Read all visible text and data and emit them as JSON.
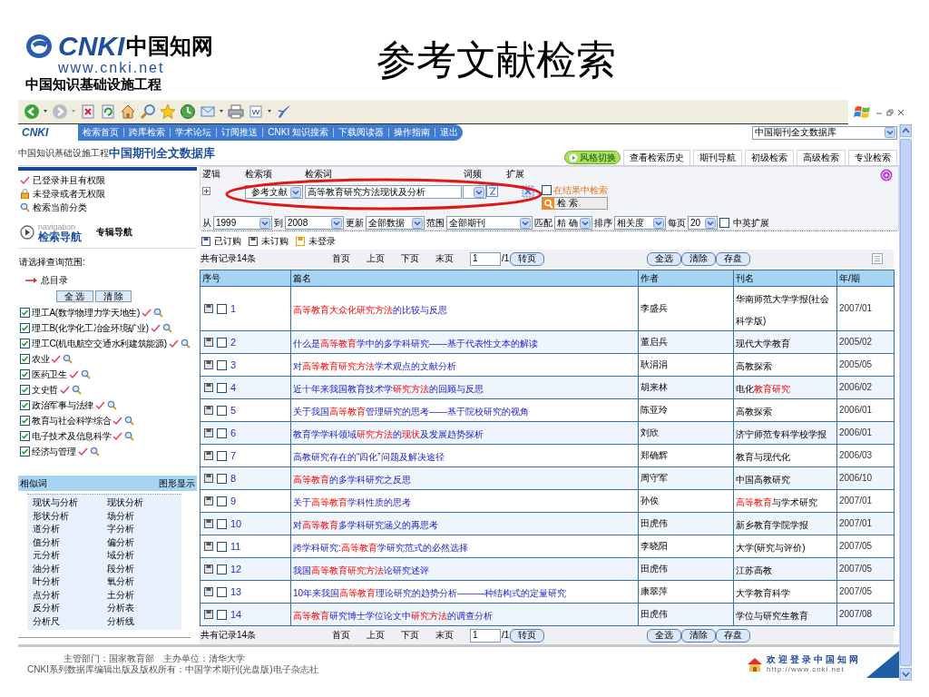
{
  "slide": {
    "logo_text": "CNKI",
    "logo_cn": "中国知网",
    "logo_url": "www.cnki.net",
    "logo_tagline": "中国知识基础设施工程",
    "title": "参考文献检索"
  },
  "site_nav": {
    "logo_text": "CNKI",
    "logo_tagline": "中国知识基础设施工程",
    "links": [
      "检索首页",
      "跨库检索",
      "学术论坛",
      "订阅推送",
      "CNKI 知识搜索",
      "下载阅读器",
      "操作指南",
      "退出"
    ],
    "db_select": "中国期刊全文数据库"
  },
  "db_title": "中国期刊全文数据库",
  "tabs": [
    {
      "kind": "switch",
      "label": "风格切换"
    },
    {
      "kind": "tab",
      "label": "查看检索历史"
    },
    {
      "kind": "tab",
      "label": "期刊导航"
    },
    {
      "kind": "tab",
      "label": "初级检索"
    },
    {
      "kind": "tab",
      "label": "高级检索"
    },
    {
      "kind": "tab",
      "label": "专业检索"
    }
  ],
  "sidebar": {
    "status": [
      {
        "kind": "authorized",
        "label": "已登录并且有权限"
      },
      {
        "kind": "locked",
        "label": "未登录或者无权限"
      },
      {
        "kind": "search",
        "label": "检索当前分类"
      }
    ],
    "nav_caption": "navigation",
    "nav_title": "检索导航",
    "nav_alt": "专辑导航",
    "scope_label": "请选择查询范围:",
    "root": "总目录",
    "buttons": [
      "全 选",
      "清 除"
    ],
    "categories": [
      {
        "label": "理工A(数学物理力学天地生)",
        "checked": true
      },
      {
        "label": "理工B(化学化工冶金环境矿业)",
        "checked": true
      },
      {
        "label": "理工C(机电航空交通水利建筑能源)",
        "checked": true
      },
      {
        "label": "农业",
        "checked": true
      },
      {
        "label": "医药卫生",
        "checked": true
      },
      {
        "label": "文史哲",
        "checked": true
      },
      {
        "label": "政治军事与法律",
        "checked": true
      },
      {
        "label": "教育与社会科学综合",
        "checked": true
      },
      {
        "label": "电子技术及信息科学",
        "checked": true
      },
      {
        "label": "经济与管理",
        "checked": true
      }
    ],
    "similar": {
      "title": "相似词",
      "graph_link": "图形显示",
      "words": [
        "现状与分析",
        "现状分析",
        "形状分析",
        "场分析",
        "道分析",
        "字分析",
        "值分析",
        "偏分析",
        "元分析",
        "域分析",
        "油分析",
        "段分析",
        "叶分析",
        "氧分析",
        "点分析",
        "土分析",
        "反分析",
        "分析表",
        "分析尺",
        "分析线"
      ]
    }
  },
  "search": {
    "headers": [
      "逻辑",
      "检索项",
      "检索词",
      "词频",
      "扩展"
    ],
    "field": "参考文献",
    "term": "高等教育研究方法现状及分析",
    "in_results": {
      "label": "在结果中检索",
      "checked": false
    },
    "button": "检 索",
    "filters": [
      {
        "label": "从",
        "value": "1999"
      },
      {
        "label": "到",
        "value": "2008"
      },
      {
        "label": "更新",
        "value": "全部数据"
      },
      {
        "label": "范围",
        "value": "全部期刊"
      },
      {
        "label": "匹配",
        "value": "精 确"
      },
      {
        "label": "排序",
        "value": "相关度"
      },
      {
        "label": "每页",
        "value": "20"
      }
    ],
    "bilingual": {
      "label": "中英扩展",
      "checked": false
    }
  },
  "legend": [
    "已订购",
    "未订购",
    "未登录"
  ],
  "pager_top": {
    "total": "共有记录14条",
    "links": [
      "首页",
      "上页",
      "下页",
      "末页"
    ],
    "page": "1",
    "pages": "/1",
    "go": "转页",
    "actions": [
      "全选",
      "清除",
      "存盘"
    ]
  },
  "table": {
    "columns": [
      "序号",
      "篇名",
      "作者",
      "刊名",
      "年/期"
    ],
    "rows": [
      {
        "no": "1",
        "checked": false,
        "title": [
          {
            "text": "高等教育大众化研究方法",
            "hit": true
          },
          {
            "text": "的比较与反思",
            "hit": false
          }
        ],
        "author": "李盛兵",
        "journal": [
          {
            "text": "华南师范大学学报(社会科学版)",
            "hit": false
          }
        ],
        "issue": "2007/01"
      },
      {
        "no": "2",
        "checked": false,
        "title": [
          {
            "text": "什么是",
            "hit": false
          },
          {
            "text": "高等教育",
            "hit": true
          },
          {
            "text": "学中的多学科研究——基于代表性文本的解读",
            "hit": false
          }
        ],
        "author": "董启兵",
        "journal": [
          {
            "text": "现代大学教育",
            "hit": false
          }
        ],
        "issue": "2005/02"
      },
      {
        "no": "3",
        "checked": false,
        "title": [
          {
            "text": "对",
            "hit": false
          },
          {
            "text": "高等教育研究方法",
            "hit": true
          },
          {
            "text": "学术观点的文献分析",
            "hit": false
          }
        ],
        "author": "耿涓涓",
        "journal": [
          {
            "text": "高教探索",
            "hit": false
          }
        ],
        "issue": "2005/05"
      },
      {
        "no": "4",
        "checked": false,
        "title": [
          {
            "text": "近十年来我国教育技术学",
            "hit": false
          },
          {
            "text": "研究方法",
            "hit": true
          },
          {
            "text": "的回顾与反思",
            "hit": false
          }
        ],
        "author": "胡来林",
        "journal": [
          {
            "text": "电化",
            "hit": false
          },
          {
            "text": "教育研究",
            "hit": true
          }
        ],
        "issue": "2006/02"
      },
      {
        "no": "5",
        "checked": false,
        "title": [
          {
            "text": "关于我国",
            "hit": false
          },
          {
            "text": "高等教育",
            "hit": true
          },
          {
            "text": "管理研究的思考——基于院校研究的视角",
            "hit": false
          }
        ],
        "author": "陈亚玲",
        "journal": [
          {
            "text": "高教探索",
            "hit": false
          }
        ],
        "issue": "2006/01"
      },
      {
        "no": "6",
        "checked": false,
        "title": [
          {
            "text": "教育学学科领域",
            "hit": false
          },
          {
            "text": "研究方法",
            "hit": true
          },
          {
            "text": "的",
            "hit": false
          },
          {
            "text": "现状",
            "hit": true
          },
          {
            "text": "及发展趋势探析",
            "hit": false
          }
        ],
        "author": "刘欣",
        "journal": [
          {
            "text": "济宁师范专科学校学报",
            "hit": false
          }
        ],
        "issue": "2006/01"
      },
      {
        "no": "7",
        "checked": false,
        "title": [
          {
            "text": "高教研究存在的“四化”问题及解决途径",
            "hit": false
          }
        ],
        "author": "郑确辉",
        "journal": [
          {
            "text": "教育与现代化",
            "hit": false
          }
        ],
        "issue": "2006/03"
      },
      {
        "no": "8",
        "checked": false,
        "title": [
          {
            "text": "高等教育",
            "hit": true
          },
          {
            "text": "的多学科研究之反思",
            "hit": false
          }
        ],
        "author": "周守军",
        "journal": [
          {
            "text": "中国高教研究",
            "hit": false
          }
        ],
        "issue": "2006/10"
      },
      {
        "no": "9",
        "checked": false,
        "title": [
          {
            "text": "关于",
            "hit": false
          },
          {
            "text": "高等教育",
            "hit": true
          },
          {
            "text": "学科性质的思考",
            "hit": false
          }
        ],
        "author": "孙俟",
        "journal": [
          {
            "text": "高等教育",
            "hit": true
          },
          {
            "text": "与学术研究",
            "hit": false
          }
        ],
        "issue": "2007/01"
      },
      {
        "no": "10",
        "checked": false,
        "title": [
          {
            "text": "对",
            "hit": false
          },
          {
            "text": "高等教育",
            "hit": true
          },
          {
            "text": "多学科研究涵义的再思考",
            "hit": false
          }
        ],
        "author": "田虎伟",
        "journal": [
          {
            "text": "新乡教育学院学报",
            "hit": false
          }
        ],
        "issue": "2007/01"
      },
      {
        "no": "11",
        "checked": false,
        "title": [
          {
            "text": "跨学科研究:",
            "hit": false
          },
          {
            "text": "高等教育",
            "hit": true
          },
          {
            "text": "学研究范式的必然选择",
            "hit": false
          }
        ],
        "author": "李晓阳",
        "journal": [
          {
            "text": "大学(研究与评价)",
            "hit": false
          }
        ],
        "issue": "2007/05"
      },
      {
        "no": "12",
        "checked": false,
        "title": [
          {
            "text": "我国",
            "hit": false
          },
          {
            "text": "高等教育研究方法",
            "hit": true
          },
          {
            "text": "论研究述评",
            "hit": false
          }
        ],
        "author": "田虎伟",
        "journal": [
          {
            "text": "江苏高教",
            "hit": false
          }
        ],
        "issue": "2007/05"
      },
      {
        "no": "13",
        "checked": false,
        "title": [
          {
            "text": "10年来我国",
            "hit": false
          },
          {
            "text": "高等教育",
            "hit": true
          },
          {
            "text": "理论研究的趋势分析———种结构式的定量研究",
            "hit": false
          }
        ],
        "author": "康翠萍",
        "journal": [
          {
            "text": "大学教育科学",
            "hit": false
          }
        ],
        "issue": "2007/05"
      },
      {
        "no": "14",
        "checked": false,
        "title": [
          {
            "text": "高等教育",
            "hit": true
          },
          {
            "text": "研究博士学位论文中",
            "hit": false
          },
          {
            "text": "研究方法",
            "hit": true
          },
          {
            "text": "的调查分析",
            "hit": false
          }
        ],
        "author": "田虎伟",
        "journal": [
          {
            "text": "学位与研究生教育",
            "hit": false
          }
        ],
        "issue": "2007/08"
      }
    ]
  },
  "pager_bottom": {
    "total": "共有记录14条",
    "links": [
      "首页",
      "上页",
      "下页",
      "末页"
    ],
    "page": "1",
    "pages": "/1",
    "go": "转页",
    "actions": [
      "全选",
      "清除",
      "存盘"
    ]
  },
  "footer": {
    "lines": [
      "主管部门：国家教育部　主办单位：清华大学",
      "CNKI系列数据库编辑出版及版权所有：中国学术期刊(光盘版)电子杂志社"
    ],
    "welcome": "欢迎登录中国知网",
    "url": "http://www.cnki.net"
  }
}
